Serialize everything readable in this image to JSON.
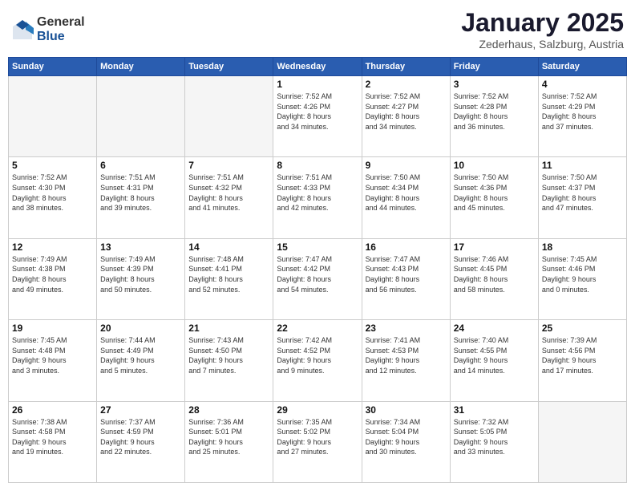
{
  "logo": {
    "general": "General",
    "blue": "Blue"
  },
  "header": {
    "month": "January 2025",
    "location": "Zederhaus, Salzburg, Austria"
  },
  "days_of_week": [
    "Sunday",
    "Monday",
    "Tuesday",
    "Wednesday",
    "Thursday",
    "Friday",
    "Saturday"
  ],
  "weeks": [
    [
      {
        "day": "",
        "info": ""
      },
      {
        "day": "",
        "info": ""
      },
      {
        "day": "",
        "info": ""
      },
      {
        "day": "1",
        "info": "Sunrise: 7:52 AM\nSunset: 4:26 PM\nDaylight: 8 hours\nand 34 minutes."
      },
      {
        "day": "2",
        "info": "Sunrise: 7:52 AM\nSunset: 4:27 PM\nDaylight: 8 hours\nand 34 minutes."
      },
      {
        "day": "3",
        "info": "Sunrise: 7:52 AM\nSunset: 4:28 PM\nDaylight: 8 hours\nand 36 minutes."
      },
      {
        "day": "4",
        "info": "Sunrise: 7:52 AM\nSunset: 4:29 PM\nDaylight: 8 hours\nand 37 minutes."
      }
    ],
    [
      {
        "day": "5",
        "info": "Sunrise: 7:52 AM\nSunset: 4:30 PM\nDaylight: 8 hours\nand 38 minutes."
      },
      {
        "day": "6",
        "info": "Sunrise: 7:51 AM\nSunset: 4:31 PM\nDaylight: 8 hours\nand 39 minutes."
      },
      {
        "day": "7",
        "info": "Sunrise: 7:51 AM\nSunset: 4:32 PM\nDaylight: 8 hours\nand 41 minutes."
      },
      {
        "day": "8",
        "info": "Sunrise: 7:51 AM\nSunset: 4:33 PM\nDaylight: 8 hours\nand 42 minutes."
      },
      {
        "day": "9",
        "info": "Sunrise: 7:50 AM\nSunset: 4:34 PM\nDaylight: 8 hours\nand 44 minutes."
      },
      {
        "day": "10",
        "info": "Sunrise: 7:50 AM\nSunset: 4:36 PM\nDaylight: 8 hours\nand 45 minutes."
      },
      {
        "day": "11",
        "info": "Sunrise: 7:50 AM\nSunset: 4:37 PM\nDaylight: 8 hours\nand 47 minutes."
      }
    ],
    [
      {
        "day": "12",
        "info": "Sunrise: 7:49 AM\nSunset: 4:38 PM\nDaylight: 8 hours\nand 49 minutes."
      },
      {
        "day": "13",
        "info": "Sunrise: 7:49 AM\nSunset: 4:39 PM\nDaylight: 8 hours\nand 50 minutes."
      },
      {
        "day": "14",
        "info": "Sunrise: 7:48 AM\nSunset: 4:41 PM\nDaylight: 8 hours\nand 52 minutes."
      },
      {
        "day": "15",
        "info": "Sunrise: 7:47 AM\nSunset: 4:42 PM\nDaylight: 8 hours\nand 54 minutes."
      },
      {
        "day": "16",
        "info": "Sunrise: 7:47 AM\nSunset: 4:43 PM\nDaylight: 8 hours\nand 56 minutes."
      },
      {
        "day": "17",
        "info": "Sunrise: 7:46 AM\nSunset: 4:45 PM\nDaylight: 8 hours\nand 58 minutes."
      },
      {
        "day": "18",
        "info": "Sunrise: 7:45 AM\nSunset: 4:46 PM\nDaylight: 9 hours\nand 0 minutes."
      }
    ],
    [
      {
        "day": "19",
        "info": "Sunrise: 7:45 AM\nSunset: 4:48 PM\nDaylight: 9 hours\nand 3 minutes."
      },
      {
        "day": "20",
        "info": "Sunrise: 7:44 AM\nSunset: 4:49 PM\nDaylight: 9 hours\nand 5 minutes."
      },
      {
        "day": "21",
        "info": "Sunrise: 7:43 AM\nSunset: 4:50 PM\nDaylight: 9 hours\nand 7 minutes."
      },
      {
        "day": "22",
        "info": "Sunrise: 7:42 AM\nSunset: 4:52 PM\nDaylight: 9 hours\nand 9 minutes."
      },
      {
        "day": "23",
        "info": "Sunrise: 7:41 AM\nSunset: 4:53 PM\nDaylight: 9 hours\nand 12 minutes."
      },
      {
        "day": "24",
        "info": "Sunrise: 7:40 AM\nSunset: 4:55 PM\nDaylight: 9 hours\nand 14 minutes."
      },
      {
        "day": "25",
        "info": "Sunrise: 7:39 AM\nSunset: 4:56 PM\nDaylight: 9 hours\nand 17 minutes."
      }
    ],
    [
      {
        "day": "26",
        "info": "Sunrise: 7:38 AM\nSunset: 4:58 PM\nDaylight: 9 hours\nand 19 minutes."
      },
      {
        "day": "27",
        "info": "Sunrise: 7:37 AM\nSunset: 4:59 PM\nDaylight: 9 hours\nand 22 minutes."
      },
      {
        "day": "28",
        "info": "Sunrise: 7:36 AM\nSunset: 5:01 PM\nDaylight: 9 hours\nand 25 minutes."
      },
      {
        "day": "29",
        "info": "Sunrise: 7:35 AM\nSunset: 5:02 PM\nDaylight: 9 hours\nand 27 minutes."
      },
      {
        "day": "30",
        "info": "Sunrise: 7:34 AM\nSunset: 5:04 PM\nDaylight: 9 hours\nand 30 minutes."
      },
      {
        "day": "31",
        "info": "Sunrise: 7:32 AM\nSunset: 5:05 PM\nDaylight: 9 hours\nand 33 minutes."
      },
      {
        "day": "",
        "info": ""
      }
    ]
  ]
}
